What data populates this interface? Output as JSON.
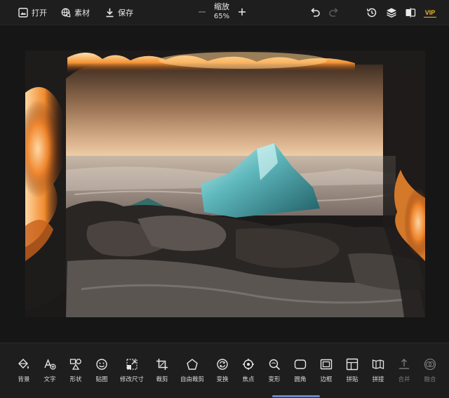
{
  "topbar": {
    "open_label": "打开",
    "assets_label": "素材",
    "save_label": "保存",
    "zoom_label": "缩放",
    "zoom_value": "65%",
    "vip_label": "VIP"
  },
  "tools": [
    {
      "label": "背景",
      "icon": "paint-bucket-icon"
    },
    {
      "label": "文字",
      "icon": "text-add-icon"
    },
    {
      "label": "形状",
      "icon": "shapes-icon"
    },
    {
      "label": "贴图",
      "icon": "smiley-icon"
    },
    {
      "label": "修改尺寸",
      "icon": "resize-icon"
    },
    {
      "label": "裁剪",
      "icon": "crop-icon"
    },
    {
      "label": "自由裁剪",
      "icon": "free-crop-icon"
    },
    {
      "label": "变换",
      "icon": "transform-icon"
    },
    {
      "label": "焦点",
      "icon": "focus-icon"
    },
    {
      "label": "变形",
      "icon": "warp-icon"
    },
    {
      "label": "圆角",
      "icon": "rounded-corner-icon"
    },
    {
      "label": "边框",
      "icon": "border-icon"
    },
    {
      "label": "拼贴",
      "icon": "collage-icon"
    },
    {
      "label": "拼接",
      "icon": "stitch-icon"
    },
    {
      "label": "合并",
      "icon": "merge-icon",
      "disabled": true
    },
    {
      "label": "融合",
      "icon": "blend-icon",
      "disabled": true
    }
  ],
  "colors": {
    "background": "#161616",
    "toolbar": "#1e1e1e",
    "vip": "#f2b431",
    "scroll_indicator": "#6a87c9"
  }
}
